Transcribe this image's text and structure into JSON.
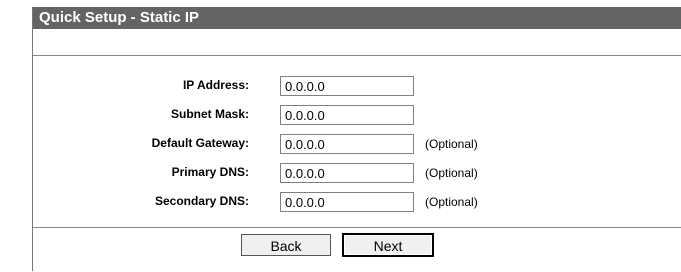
{
  "title": "Quick Setup - Static IP",
  "fields": [
    {
      "label": "IP Address:",
      "value": "0.0.0.0",
      "note": ""
    },
    {
      "label": "Subnet Mask:",
      "value": "0.0.0.0",
      "note": ""
    },
    {
      "label": "Default Gateway:",
      "value": "0.0.0.0",
      "note": "(Optional)"
    },
    {
      "label": "Primary DNS:",
      "value": "0.0.0.0",
      "note": "(Optional)"
    },
    {
      "label": "Secondary DNS:",
      "value": "0.0.0.0",
      "note": "(Optional)"
    }
  ],
  "buttons": {
    "back_label": "Back",
    "next_label": "Next"
  }
}
